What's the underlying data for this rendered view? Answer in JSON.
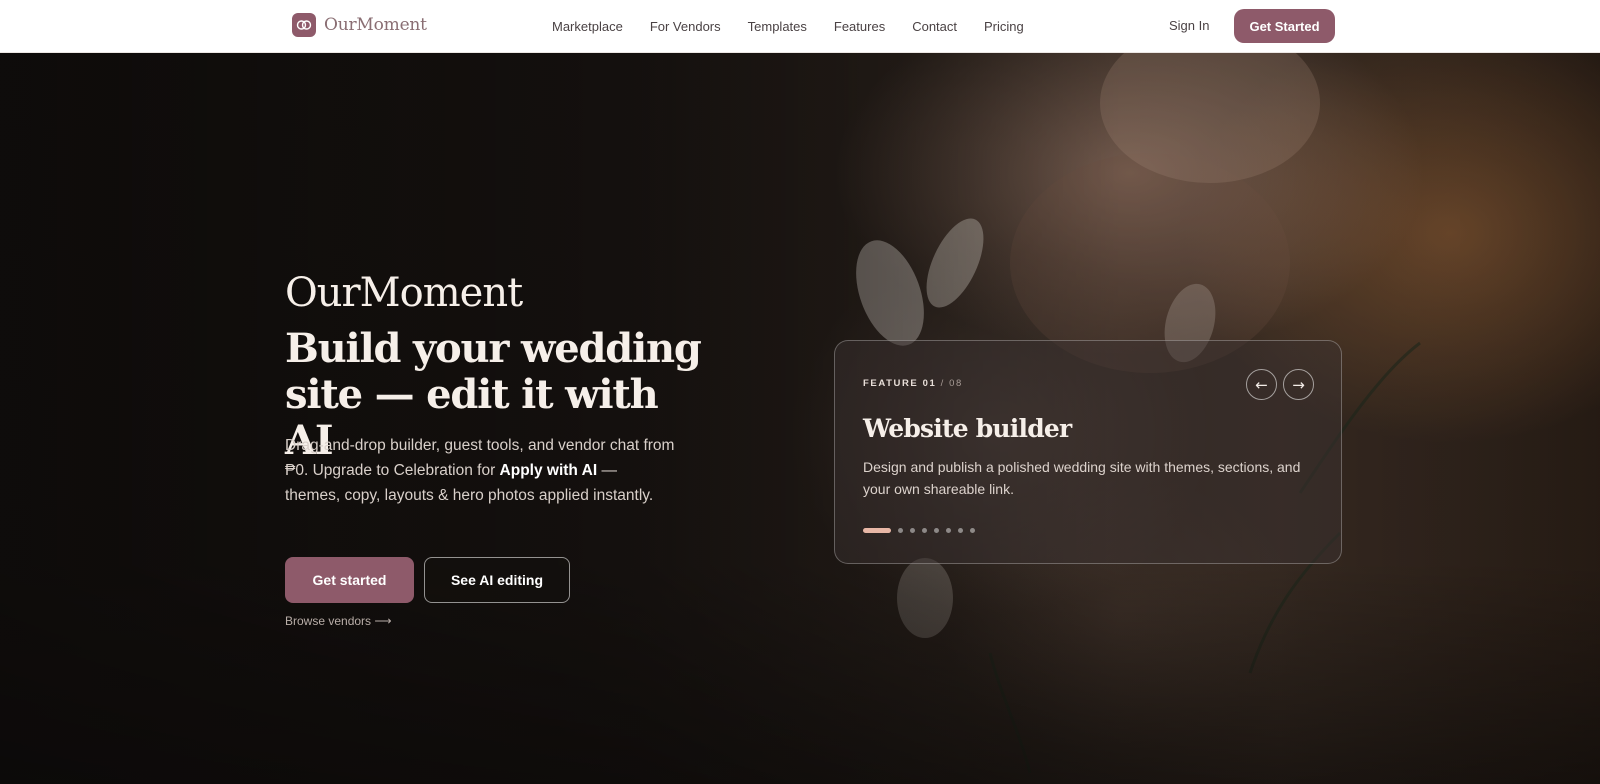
{
  "nav": {
    "logo_text": "OurMoment",
    "links": [
      "Marketplace",
      "For Vendors",
      "Templates",
      "Features",
      "Contact",
      "Pricing"
    ],
    "sign_in": "Sign In",
    "cta": "Get Started"
  },
  "hero": {
    "brand": "OurMoment",
    "headline": "Build your wedding site — edit it with AI",
    "sub_part1": "Drag-and-drop builder, guest tools, and vendor chat from ₱0. Upgrade to Celebration for ",
    "sub_bold": "Apply with AI",
    "sub_part2": " — themes, copy, layouts & hero photos applied instantly.",
    "primary_button": "Get started",
    "secondary_button": "See AI editing",
    "browse_link": "Browse vendors ⟶"
  },
  "feature_card": {
    "eyebrow": "FEATURE 01",
    "total": " / 08",
    "prev_icon": "←",
    "next_icon": "→",
    "title": "Website builder",
    "description": "Design and publish a polished wedding site with themes, sections, and your own shareable link.",
    "slide_count": 8,
    "active_slide": 1
  },
  "colors": {
    "brand": "#8e5a6a",
    "dot_active": "#e8b7a6"
  }
}
